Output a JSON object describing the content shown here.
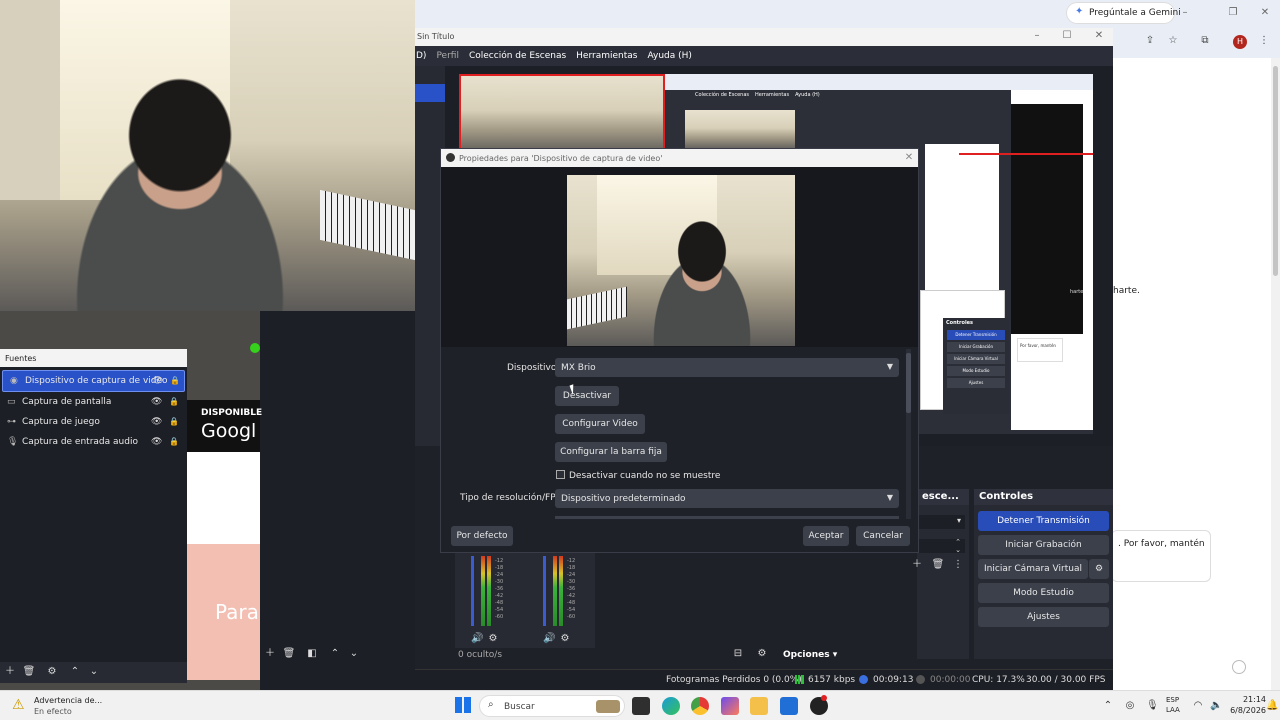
{
  "browser": {
    "gemini_button": "Pregúntale a Gemini",
    "profile_letter": "H",
    "side_text": "harte.",
    "chat_bubble": ". Por favor, mantén"
  },
  "obs": {
    "title": "Sin Título",
    "menu": [
      "D)",
      "Perfil",
      "Colección de Escenas",
      "Herramientas",
      "Ayuda (H)"
    ],
    "sources": {
      "title": "Fuentes",
      "items": [
        {
          "label": "Dispositivo de captura de video",
          "icon": "camera-icon",
          "selected": true
        },
        {
          "label": "Captura de pantalla",
          "icon": "monitor-icon",
          "selected": false
        },
        {
          "label": "Captura de juego",
          "icon": "gamepad-icon",
          "selected": false
        },
        {
          "label": "Captura de entrada audio",
          "icon": "microphone-icon",
          "selected": false
        }
      ]
    },
    "ad": {
      "line1": "DISPONIBLE",
      "line2": "Googl",
      "line3": "Para"
    },
    "controls": {
      "title": "Controles",
      "buttons": [
        "Detener Transmisión",
        "Iniciar Grabación",
        "Iniciar Cámara Virtual",
        "Modo Estudio",
        "Ajustes"
      ]
    },
    "transitions_title": "esce...",
    "hidden_count": "0 oculto/s",
    "options_label": "Opciones",
    "status": {
      "dropped": "Fotogramas Perdidos 0 (0.0%)",
      "bitrate": "6157 kbps",
      "stream_time": "00:09:13",
      "rec_time": "00:00:00",
      "cpu": "CPU: 17.3%",
      "fps": "30.00 / 30.00 FPS"
    },
    "meter_ticks": [
      "-12",
      "-18",
      "-24",
      "-30",
      "-36",
      "-42",
      "-48",
      "-54",
      "-60"
    ]
  },
  "dialog": {
    "title": "Propiedades para 'Dispositivo de captura de video'",
    "device_label": "Dispositivo",
    "device_value": "MX Brio",
    "btn_deactivate": "Desactivar",
    "btn_configure_video": "Configurar Video",
    "btn_configure_bar": "Configurar la barra fija",
    "checkbox_label": "Desactivar cuando no se muestre",
    "resolution_label": "Tipo de resolución/FPS",
    "resolution_value": "Dispositivo predeterminado",
    "btn_default": "Por defecto",
    "btn_accept": "Aceptar",
    "btn_cancel": "Cancelar"
  },
  "nested_preview": {
    "menu": [
      "Colección de Escenas",
      "Herramientas",
      "Ayuda (H)"
    ],
    "controls_title": "Controles",
    "controls": [
      "Detener Transmisión",
      "Iniciar Grabación",
      "Iniciar Cámara Virtual",
      "Modo Estudio",
      "Ajustes"
    ],
    "chat_text": "Por favor, mantén",
    "side_text": "harte"
  },
  "taskbar": {
    "warning_title": "Advertencia de...",
    "warning_sub": "En efecto",
    "search_placeholder": "Buscar",
    "lang_top": "ESP",
    "lang_bottom": "LAA",
    "time": "21:14",
    "date": "6/8/2026"
  },
  "colors": {
    "accent": "#284cb8",
    "selection": "#2a52c8",
    "dark": "#1d1f26"
  }
}
